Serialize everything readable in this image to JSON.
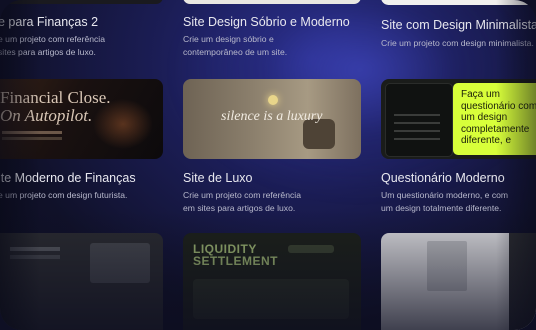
{
  "cards": [
    {
      "title": "e para Finanças 2",
      "desc1": "e um projeto com referência",
      "desc2": "sites para artigos de luxo."
    },
    {
      "title": "Site Design Sóbrio e Moderno",
      "desc1": "Crie um design sóbrio e",
      "desc2": "contemporâneo de um site."
    },
    {
      "title": "Site com Design Minimalista",
      "desc1": "Crie um projeto com design minimalista.",
      "desc2": ""
    },
    {
      "title": "ite Moderno de Finanças",
      "desc1": "e um projeto com design futurista.",
      "desc2": ""
    },
    {
      "title": "Site de Luxo",
      "desc1": "Crie um projeto com referência",
      "desc2": "em sites para artigos de luxo."
    },
    {
      "title": "Questionário Moderno",
      "desc1": "Um questionário moderno, e com",
      "desc2": "um design totalmente diferente."
    }
  ],
  "thumbs": {
    "finance_line1": "Financial Close.",
    "finance_line2": "On Autopilot.",
    "luxury_text": "silence is a luxury",
    "quiz_text": "Faça um questionário com um design completamente diferente, e",
    "liquidity_1": "LIQUIDITY",
    "liquidity_2": "SETTLEMENT"
  },
  "colors": {
    "accent_yellow": "#d8ff3a",
    "background": "#12132e"
  }
}
